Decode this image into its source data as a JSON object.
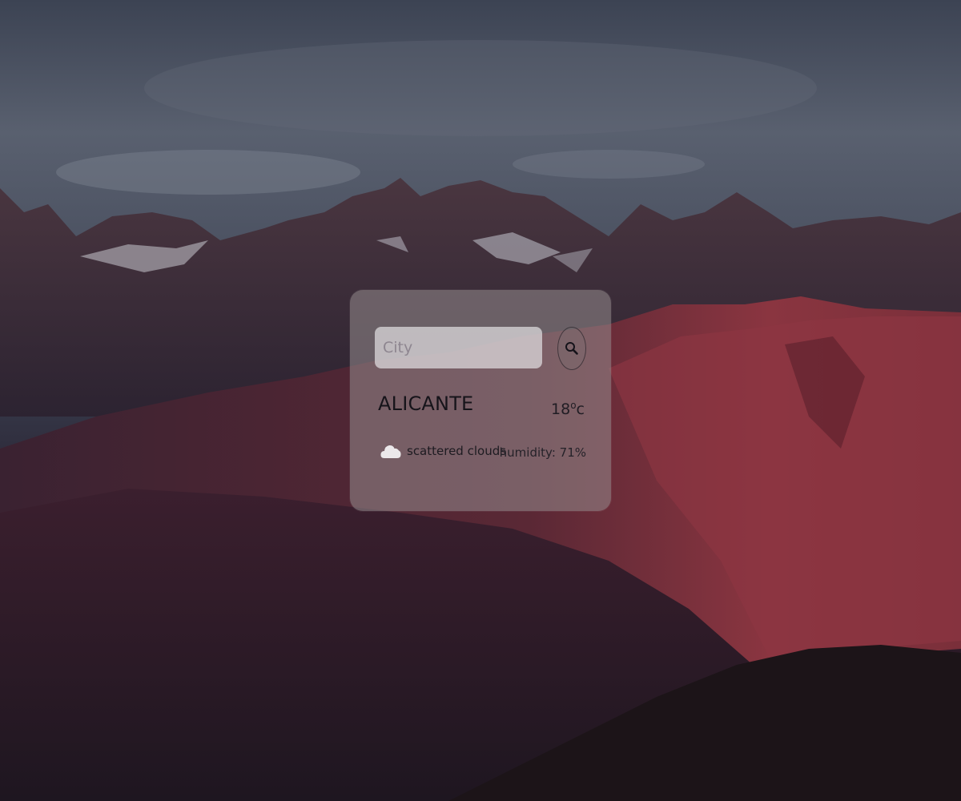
{
  "search": {
    "placeholder": "City",
    "value": "",
    "button_icon": "search-icon"
  },
  "weather": {
    "city": "ALICANTE",
    "temperature": "18",
    "unit": "oc",
    "icon": "cloud-icon",
    "description": "scattered clouds",
    "humidity_label": "humidity:",
    "humidity_value": "71%"
  },
  "colors": {
    "card_background": "#968c8e",
    "input_background": "#e1dee1",
    "text": "#16141a"
  }
}
